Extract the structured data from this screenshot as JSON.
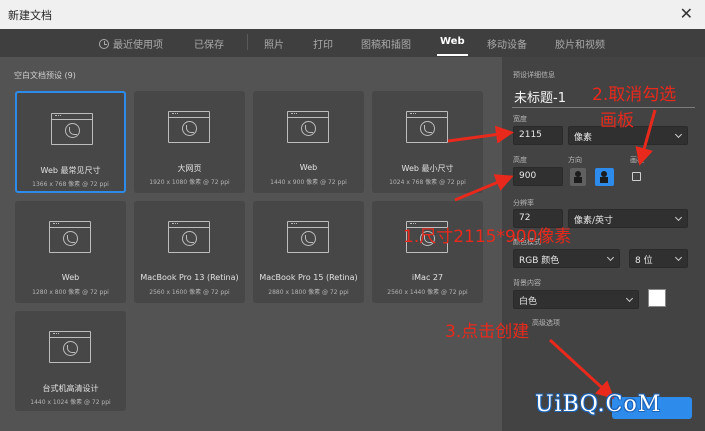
{
  "window": {
    "title": "新建文档",
    "close_glyph": "✕"
  },
  "tabs": [
    {
      "label": "最近使用项",
      "icon": "clock-icon",
      "active": false
    },
    {
      "label": "已保存",
      "active": false
    },
    {
      "label": "照片",
      "active": false
    },
    {
      "label": "打印",
      "active": false
    },
    {
      "label": "图稿和插图",
      "active": false
    },
    {
      "label": "Web",
      "active": true
    },
    {
      "label": "移动设备",
      "active": false
    },
    {
      "label": "胶片和视频",
      "active": false
    }
  ],
  "presets": {
    "title": "空白文档预设",
    "count": "(9)",
    "items": [
      {
        "name": "Web 最常见尺寸",
        "dims": "1366 x 768 像素 @ 72 ppi",
        "selected": true
      },
      {
        "name": "大网页",
        "dims": "1920 x 1080 像素 @ 72 ppi"
      },
      {
        "name": "Web",
        "dims": "1440 x 900 像素 @ 72 ppi"
      },
      {
        "name": "Web 最小尺寸",
        "dims": "1024 x 768 像素 @ 72 ppi"
      },
      {
        "name": "Web",
        "dims": "1280 x 800 像素 @ 72 ppi"
      },
      {
        "name": "MacBook Pro 13 (Retina)",
        "dims": "2560 x 1600 像素 @ 72 ppi"
      },
      {
        "name": "MacBook Pro 15 (Retina)",
        "dims": "2880 x 1800 像素 @ 72 ppi"
      },
      {
        "name": "iMac 27",
        "dims": "2560 x 1440 像素 @ 72 ppi"
      },
      {
        "name": "台式机高清设计",
        "dims": "1440 x 1024 像素 @ 72 ppi"
      }
    ]
  },
  "details": {
    "header": "预设详细信息",
    "doc_name": "未标题-1",
    "width_label": "宽度",
    "width_value": "2115",
    "width_unit": "像素",
    "height_label": "高度",
    "height_value": "900",
    "orientation_label": "方向",
    "artboard_label": "画板",
    "resolution_label": "分辨率",
    "resolution_value": "72",
    "resolution_unit": "像素/英寸",
    "color_mode_label": "颜色模式",
    "color_mode_value": "RGB 颜色",
    "bit_depth_value": "8 位",
    "background_label": "背景内容",
    "background_value": "白色",
    "advanced_label": "高级选项"
  },
  "annotations": {
    "step1": "1.尺寸2115*900像素",
    "step2_line1": "2.取消勾选",
    "step2_line2": "画板",
    "step3": "3.点击创建"
  },
  "watermark": "UiBQ.CoM",
  "colors": {
    "accent": "#2d8ceb",
    "annotation": "#e8291c",
    "panel": "#434343",
    "background": "#535353"
  }
}
